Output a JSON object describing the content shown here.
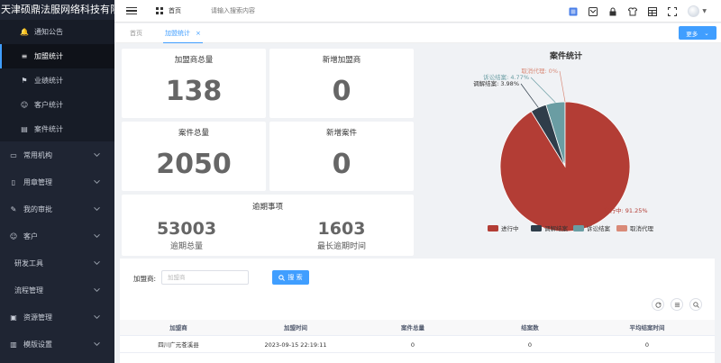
{
  "brand": {
    "title": "天津硕鼎法服网络科技有限公司"
  },
  "sidebar": {
    "items": [
      {
        "label": "通知公告",
        "type": "sub",
        "icon": "bell-icon"
      },
      {
        "label": "加盟统计",
        "type": "sub",
        "icon": "list-icon",
        "active": true
      },
      {
        "label": "业绩统计",
        "type": "sub",
        "icon": "flag-icon"
      },
      {
        "label": "客户统计",
        "type": "sub",
        "icon": "user-icon"
      },
      {
        "label": "案件统计",
        "type": "sub",
        "icon": "document-icon"
      },
      {
        "label": "常用机构",
        "type": "top",
        "icon": "institution-icon"
      },
      {
        "label": "用章管理",
        "type": "top",
        "icon": "seal-icon"
      },
      {
        "label": "我的审批",
        "type": "top",
        "icon": "approval-icon"
      },
      {
        "label": "客户",
        "type": "top",
        "icon": "customer-icon"
      },
      {
        "label": "研发工具",
        "type": "top",
        "icon": ""
      },
      {
        "label": "流程管理",
        "type": "top",
        "icon": ""
      },
      {
        "label": "资源管理",
        "type": "top",
        "icon": "resource-icon"
      },
      {
        "label": "模版设置",
        "type": "top",
        "icon": "template-icon"
      }
    ]
  },
  "header": {
    "breadcrumb": "首页",
    "search_placeholder": "请输入搜索内容"
  },
  "tabs": {
    "home": "首页",
    "active": "加盟统计",
    "close": "×",
    "more_label": "更多"
  },
  "stats": {
    "franchisee_total": {
      "title": "加盟商总量",
      "value": "138"
    },
    "new_franchisee": {
      "title": "新增加盟商",
      "value": "0"
    },
    "case_total": {
      "title": "案件总量",
      "value": "2050"
    },
    "new_case": {
      "title": "新增案件",
      "value": "0"
    },
    "overdue": {
      "title": "逾期事项",
      "total_value": "53003",
      "total_label": "逾期总量",
      "longest_value": "1603",
      "longest_label": "最长逾期时间"
    }
  },
  "chart_data": {
    "type": "pie",
    "title": "案件统计",
    "slices": [
      {
        "name": "进行中",
        "value": 91.25,
        "label": "进行中: 91.25%",
        "color": "#b33d35"
      },
      {
        "name": "调解结案",
        "value": 3.98,
        "label": "调解结案: 3.98%",
        "color": "#2f3d4a"
      },
      {
        "name": "诉讼结案",
        "value": 4.77,
        "label": "诉讼结案: 4.77%",
        "color": "#6a9da3"
      },
      {
        "name": "取消代理",
        "value": 0,
        "label": "取消代理: 0%",
        "color": "#d98a78"
      }
    ],
    "legend_position": "bottom"
  },
  "filter": {
    "label": "加盟商:",
    "placeholder": "加盟商",
    "search_label": "搜 索"
  },
  "table": {
    "columns": [
      "加盟商",
      "加盟时间",
      "案件总量",
      "结案数",
      "平均结案时间"
    ],
    "rows": [
      [
        "四川广元苍溪县",
        "2023-09-15 22:19:11",
        "0",
        "0",
        "0"
      ]
    ]
  },
  "colors": {
    "primary": "#409eff",
    "sidebar_bg": "#1f2533"
  }
}
